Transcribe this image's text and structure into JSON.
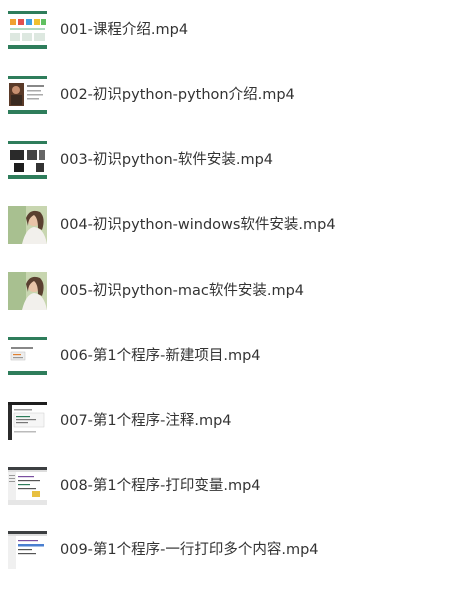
{
  "file_list": {
    "items": [
      {
        "name": "001-课程介绍.mp4",
        "thumbnail": "slide-course-intro"
      },
      {
        "name": "002-初识python-python介绍.mp4",
        "thumbnail": "slide-with-photo"
      },
      {
        "name": "003-初识python-软件安装.mp4",
        "thumbnail": "slide-dark-images"
      },
      {
        "name": "004-初识python-windows软件安装.mp4",
        "thumbnail": "photo-person"
      },
      {
        "name": "005-初识python-mac软件安装.mp4",
        "thumbnail": "photo-person"
      },
      {
        "name": "006-第1个程序-新建项目.mp4",
        "thumbnail": "slide-green-bar"
      },
      {
        "name": "007-第1个程序-注释.mp4",
        "thumbnail": "screen-editor-dark"
      },
      {
        "name": "008-第1个程序-打印变量.mp4",
        "thumbnail": "screen-editor-light"
      },
      {
        "name": "009-第1个程序-一行打印多个内容.mp4",
        "thumbnail": "screen-editor-light"
      }
    ]
  },
  "colors": {
    "text": "#333333",
    "slide_green": "#2e7d5b",
    "background": "#ffffff"
  }
}
